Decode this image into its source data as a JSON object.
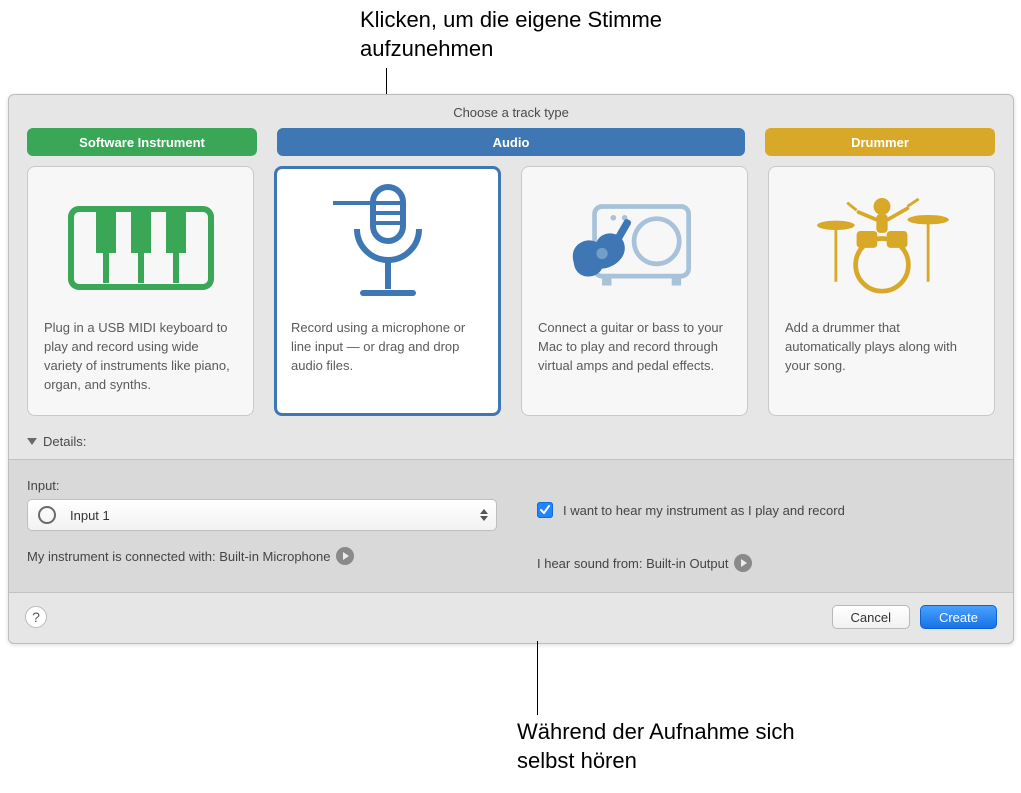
{
  "annotations": {
    "top": "Klicken, um die eigene Stimme aufzunehmen",
    "bottom": "Während der Aufnahme sich selbst hören"
  },
  "header": {
    "title": "Choose a track type"
  },
  "tabs": {
    "software": "Software Instrument",
    "audio": "Audio",
    "drummer": "Drummer"
  },
  "cards": {
    "software": {
      "desc": "Plug in a USB MIDI keyboard to play and record using wide variety of instruments like piano, organ, and synths."
    },
    "mic": {
      "desc": "Record using a microphone or line input — or drag and drop audio files."
    },
    "guitar": {
      "desc": "Connect a guitar or bass to your Mac to play and record through virtual amps and pedal effects."
    },
    "drummer": {
      "desc": "Add a drummer that automatically plays along with your song."
    }
  },
  "details": {
    "toggle_label": "Details:",
    "input_label": "Input:",
    "input_value": "Input 1",
    "connected_text": "My instrument is connected with: Built-in Microphone",
    "monitor_label": "I want to hear my instrument as I play and record",
    "output_text": "I hear sound from: Built-in Output"
  },
  "buttons": {
    "help": "?",
    "cancel": "Cancel",
    "create": "Create"
  }
}
